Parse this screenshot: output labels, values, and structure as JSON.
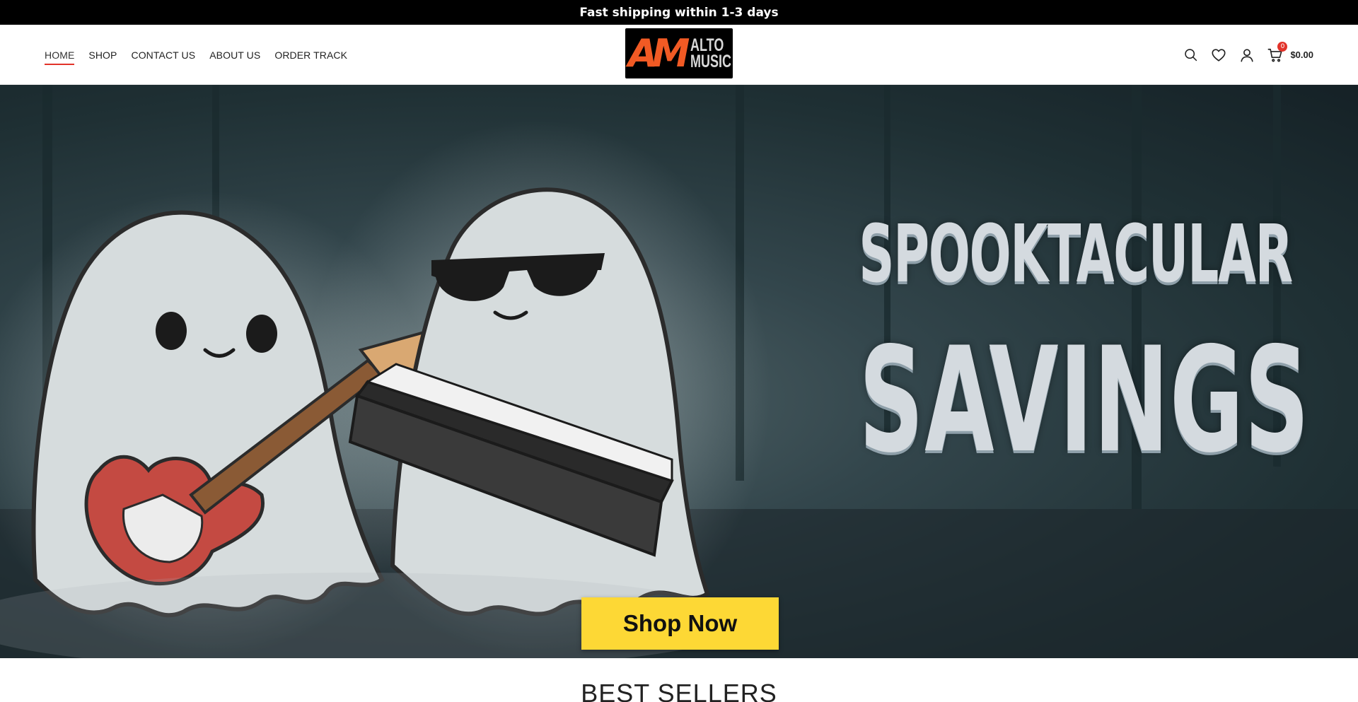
{
  "announcement": "Fast shipping within 1-3 days",
  "nav": {
    "items": [
      {
        "label": "HOME",
        "active": true
      },
      {
        "label": "SHOP"
      },
      {
        "label": "CONTACT US"
      },
      {
        "label": "ABOUT US"
      },
      {
        "label": "ORDER TRACK"
      }
    ]
  },
  "logo": {
    "monogram": "AM",
    "line1": "ALTO",
    "line2": "MUSIC"
  },
  "tools": {
    "icons": [
      "search-icon",
      "heart-icon",
      "user-icon",
      "cart-icon"
    ],
    "cart_count": "0",
    "cart_total": "$0.00"
  },
  "hero": {
    "line1": "SPOOKTACULAR",
    "line2": "SAVINGS",
    "cta": "Shop Now"
  },
  "section_title": "BEST SELLERS",
  "colors": {
    "accent": "#e2332a",
    "cta": "#fdd835",
    "logo_orange": "#f15a24"
  }
}
